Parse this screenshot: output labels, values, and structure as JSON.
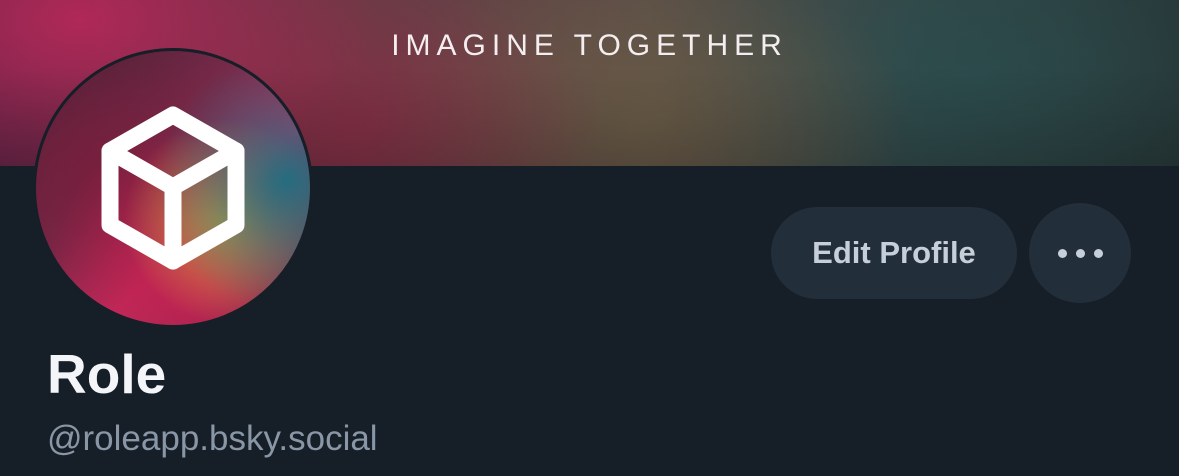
{
  "banner": {
    "text": "IMAGINE TOGETHER"
  },
  "avatar": {
    "icon": "cube-icon"
  },
  "actions": {
    "edit_label": "Edit Profile",
    "more_icon": "more-horizontal-icon"
  },
  "profile": {
    "display_name": "Role",
    "handle": "@roleapp.bsky.social"
  },
  "colors": {
    "background": "#161e27",
    "button_bg": "#222e3a",
    "button_text": "#c5ced9",
    "name_text": "#f3f5f8",
    "handle_text": "#8896a6"
  }
}
